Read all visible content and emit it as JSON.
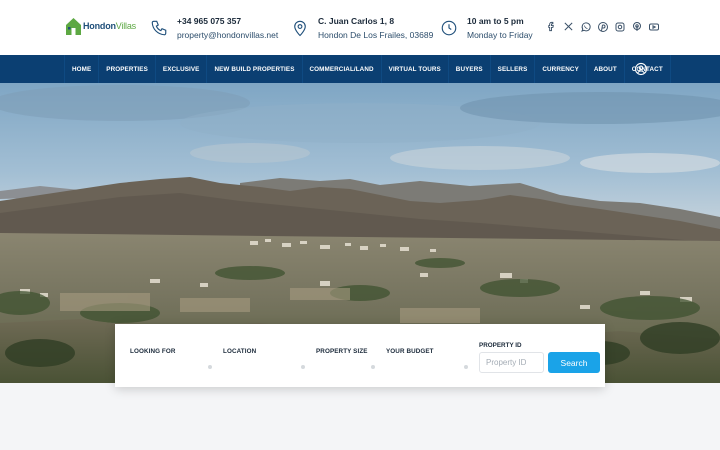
{
  "brand": {
    "name_part1": "Hondon",
    "name_part2": "Villas"
  },
  "contacts": {
    "phone": {
      "line1": "+34 965 075 357",
      "line2": "property@hondonvillas.net"
    },
    "address": {
      "line1": "C. Juan Carlos 1, 8",
      "line2": "Hondon De Los Frailes, 03689"
    },
    "hours": {
      "line1": "10 am to 5 pm",
      "line2": "Monday to Friday"
    }
  },
  "social_icons": [
    "facebook-icon",
    "x-icon",
    "whatsapp-icon",
    "pinterest-icon",
    "instagram-icon",
    "tripadvisor-icon",
    "youtube-icon"
  ],
  "nav": {
    "items": [
      "HOME",
      "PROPERTIES",
      "EXCLUSIVE",
      "NEW BUILD PROPERTIES",
      "COMMERCIAL/LAND",
      "VIRTUAL TOURS",
      "BUYERS",
      "SELLERS",
      "CURRENCY",
      "ABOUT",
      "CONTACT"
    ]
  },
  "search": {
    "looking_for": "LOOKING FOR",
    "location": "LOCATION",
    "property_size": "PROPERTY SIZE",
    "your_budget": "YOUR BUDGET",
    "property_id_label": "PROPERTY ID",
    "property_id_placeholder": "Property ID",
    "button": "Search"
  },
  "colors": {
    "nav_bg": "#0b3f72",
    "accent": "#1aa3e8",
    "brand_green": "#5da843",
    "brand_blue": "#1f4f7a"
  }
}
